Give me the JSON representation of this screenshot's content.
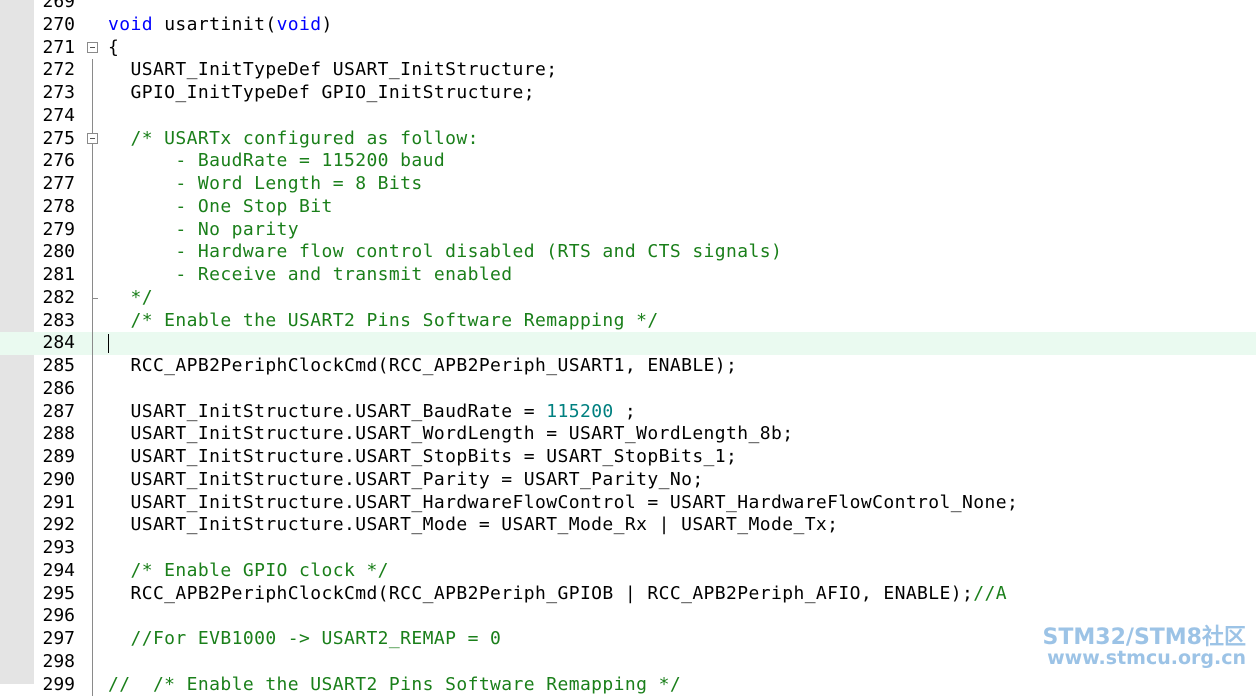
{
  "editor": {
    "lines": [
      {
        "no": "269",
        "segments": []
      },
      {
        "no": "270",
        "segments": [
          {
            "t": "kw",
            "v": "void"
          },
          {
            "t": "n",
            "v": " usartinit("
          },
          {
            "t": "kw",
            "v": "void"
          },
          {
            "t": "n",
            "v": ")"
          }
        ]
      },
      {
        "no": "271",
        "fold": "open",
        "segments": [
          {
            "t": "n",
            "v": "{"
          }
        ]
      },
      {
        "no": "272",
        "segments": [
          {
            "t": "n",
            "v": "  USART_InitTypeDef USART_InitStructure;"
          }
        ]
      },
      {
        "no": "273",
        "segments": [
          {
            "t": "n",
            "v": "  GPIO_InitTypeDef GPIO_InitStructure;"
          }
        ]
      },
      {
        "no": "274",
        "segments": []
      },
      {
        "no": "275",
        "fold": "open",
        "segments": [
          {
            "t": "cm",
            "v": "  /* USARTx configured as follow:"
          }
        ]
      },
      {
        "no": "276",
        "segments": [
          {
            "t": "cm",
            "v": "      - BaudRate = 115200 baud"
          }
        ]
      },
      {
        "no": "277",
        "segments": [
          {
            "t": "cm",
            "v": "      - Word Length = 8 Bits"
          }
        ]
      },
      {
        "no": "278",
        "segments": [
          {
            "t": "cm",
            "v": "      - One Stop Bit"
          }
        ]
      },
      {
        "no": "279",
        "segments": [
          {
            "t": "cm",
            "v": "      - No parity"
          }
        ]
      },
      {
        "no": "280",
        "segments": [
          {
            "t": "cm",
            "v": "      - Hardware flow control disabled (RTS and CTS signals)"
          }
        ]
      },
      {
        "no": "281",
        "segments": [
          {
            "t": "cm",
            "v": "      - Receive and transmit enabled"
          }
        ]
      },
      {
        "no": "282",
        "fold": "end",
        "segments": [
          {
            "t": "cm",
            "v": "  */"
          }
        ]
      },
      {
        "no": "283",
        "segments": [
          {
            "t": "cm",
            "v": "  /* Enable the USART2 Pins Software Remapping */"
          }
        ]
      },
      {
        "no": "284",
        "current": true,
        "segments": []
      },
      {
        "no": "285",
        "segments": [
          {
            "t": "n",
            "v": "  RCC_APB2PeriphClockCmd(RCC_APB2Periph_USART1, ENABLE);"
          }
        ]
      },
      {
        "no": "286",
        "segments": []
      },
      {
        "no": "287",
        "segments": [
          {
            "t": "n",
            "v": "  USART_InitStructure.USART_BaudRate = "
          },
          {
            "t": "num",
            "v": "115200"
          },
          {
            "t": "n",
            "v": " ;"
          }
        ]
      },
      {
        "no": "288",
        "segments": [
          {
            "t": "n",
            "v": "  USART_InitStructure.USART_WordLength = USART_WordLength_8b;"
          }
        ]
      },
      {
        "no": "289",
        "segments": [
          {
            "t": "n",
            "v": "  USART_InitStructure.USART_StopBits = USART_StopBits_1;"
          }
        ]
      },
      {
        "no": "290",
        "segments": [
          {
            "t": "n",
            "v": "  USART_InitStructure.USART_Parity = USART_Parity_No;"
          }
        ]
      },
      {
        "no": "291",
        "segments": [
          {
            "t": "n",
            "v": "  USART_InitStructure.USART_HardwareFlowControl = USART_HardwareFlowControl_None;"
          }
        ]
      },
      {
        "no": "292",
        "segments": [
          {
            "t": "n",
            "v": "  USART_InitStructure.USART_Mode = USART_Mode_Rx | USART_Mode_Tx;"
          }
        ]
      },
      {
        "no": "293",
        "segments": []
      },
      {
        "no": "294",
        "segments": [
          {
            "t": "cm",
            "v": "  /* Enable GPIO clock */"
          }
        ]
      },
      {
        "no": "295",
        "segments": [
          {
            "t": "n",
            "v": "  RCC_APB2PeriphClockCmd(RCC_APB2Periph_GPIOB | RCC_APB2Periph_AFIO, ENABLE);"
          },
          {
            "t": "cm",
            "v": "//A"
          }
        ]
      },
      {
        "no": "296",
        "segments": []
      },
      {
        "no": "297",
        "segments": [
          {
            "t": "cm",
            "v": "  //For EVB1000 -> USART2_REMAP = 0"
          }
        ]
      },
      {
        "no": "298",
        "segments": []
      },
      {
        "no": "299",
        "segments": [
          {
            "t": "cm",
            "v": "//  /* Enable the USART2 Pins Software Remapping */"
          }
        ]
      }
    ]
  },
  "watermark": {
    "line1": "STM32/STM8社区",
    "line2": "www.stmcu.org.cn"
  },
  "colors": {
    "keyword": "#0000ff",
    "comment": "#1a7f1a",
    "number": "#008080",
    "current_line": "#eafaf0"
  }
}
